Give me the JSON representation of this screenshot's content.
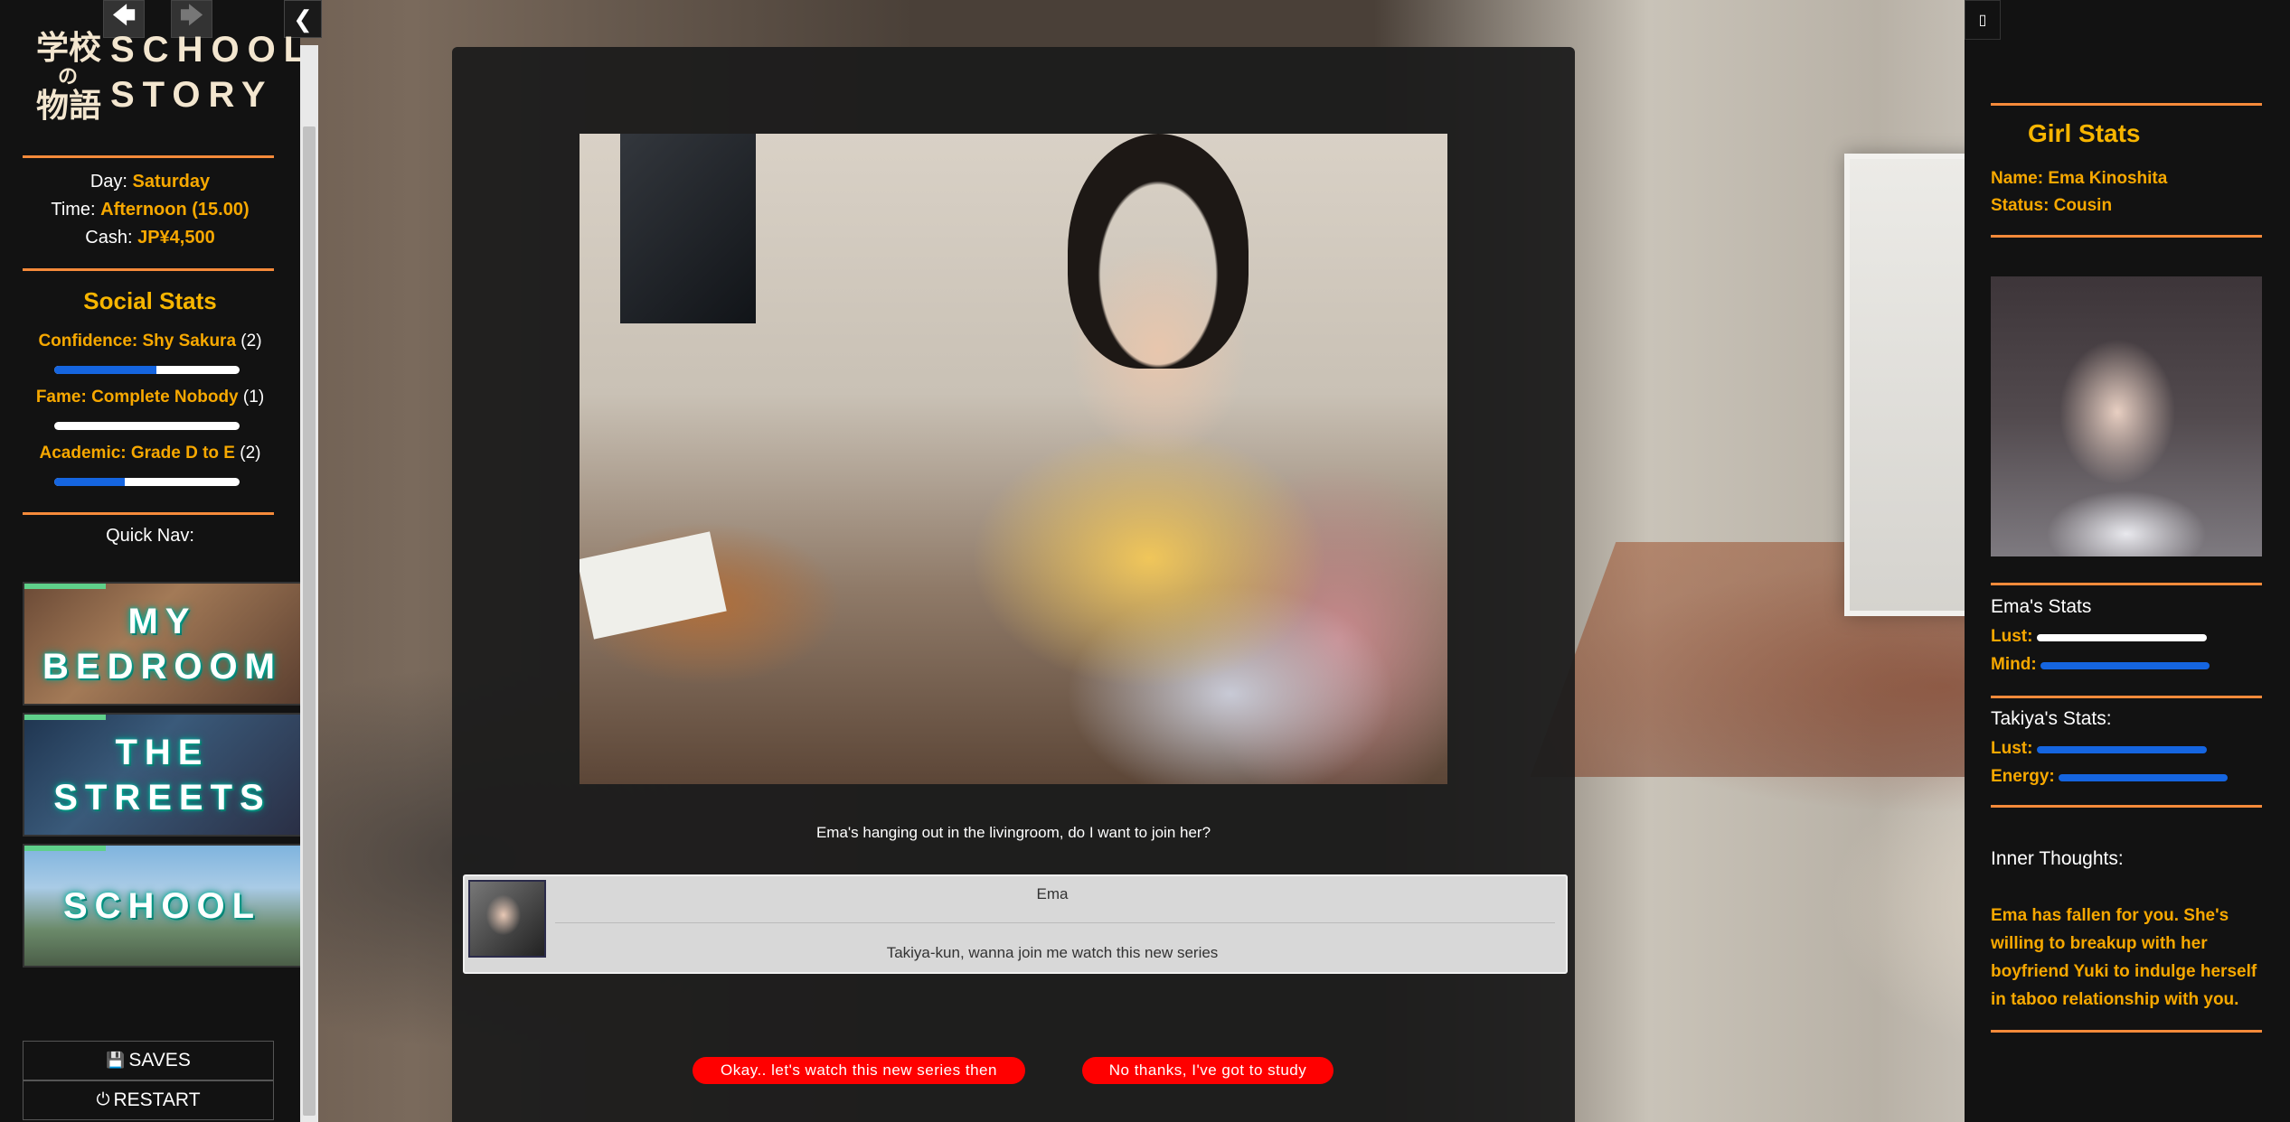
{
  "nav": {
    "back_icon": "🡄",
    "forward_icon": "🡆",
    "collapse_icon": "❮"
  },
  "logo": {
    "jp_line1": "学校",
    "jp_no": "の",
    "jp_line2": "物語",
    "en_line1": "SCHOOL",
    "en_line2": "STORY"
  },
  "status": {
    "day_label": "Day:",
    "day_value": "Saturday",
    "time_label": "Time:",
    "time_value": "Afternoon (15.00)",
    "cash_label": "Cash:",
    "cash_value": "JP¥4,500"
  },
  "social": {
    "title": "Social Stats",
    "stats": [
      {
        "label": "Confidence: Shy Sakura",
        "level": "(2)",
        "fill": 0.55
      },
      {
        "label": "Fame: Complete Nobody",
        "level": "(1)",
        "fill": 0.0
      },
      {
        "label": "Academic: Grade D to E",
        "level": "(2)",
        "fill": 0.38
      }
    ]
  },
  "quicknav": {
    "title": "Quick Nav:",
    "tiles": [
      {
        "line1": "MY",
        "line2": "BEDROOM"
      },
      {
        "line1": "THE",
        "line2": "STREETS"
      },
      {
        "line1": "SCHOOL",
        "line2": ""
      }
    ]
  },
  "system": {
    "saves_icon": "💾",
    "saves": "SAVES",
    "restart_icon": "⏻",
    "restart": "RESTART"
  },
  "scene": {
    "narration": "Ema's hanging out in the livingroom, do I want to join her?",
    "speaker": "Ema",
    "dialogue": "Takiya-kun, wanna join me watch this new series",
    "choices": [
      "Okay.. let's watch this new series then",
      "No thanks, I've got to study"
    ]
  },
  "girl": {
    "toggle_icon": "▯",
    "title": "Girl Stats",
    "name": "Name: Ema Kinoshita",
    "status": "Status: Cousin",
    "her_stats_title": "Ema's Stats",
    "her_stats": [
      {
        "label": "Lust:",
        "color": "#ffffff"
      },
      {
        "label": "Mind:",
        "color": "#1565e0"
      }
    ],
    "mc_stats_title": "Takiya's Stats:",
    "mc_stats": [
      {
        "label": "Lust:",
        "color": "#1565e0"
      },
      {
        "label": "Energy:",
        "color": "#1565e0"
      }
    ],
    "thoughts_title": "Inner Thoughts:",
    "thoughts": "Ema has fallen for you. She's willing to breakup with her boyfriend Yuki to indulge herself in taboo relationship with you."
  }
}
